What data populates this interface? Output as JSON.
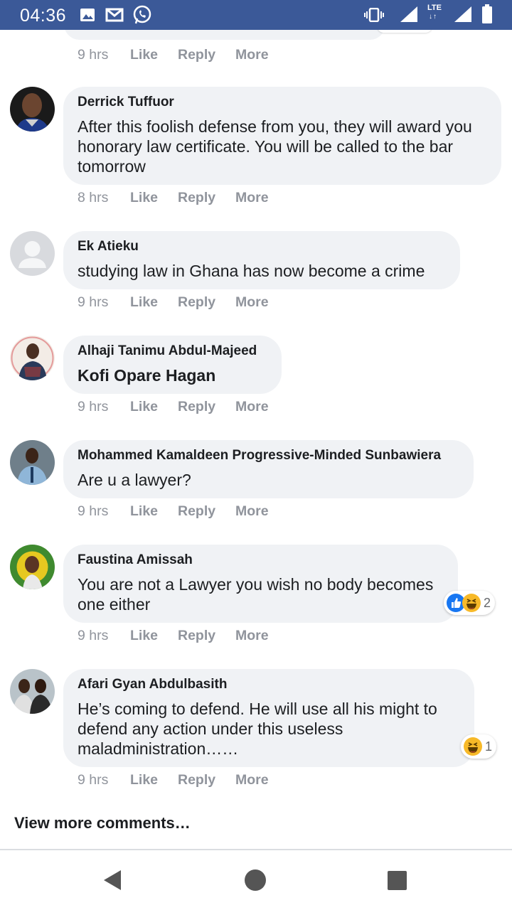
{
  "status_bar": {
    "time": "04:36",
    "network_label": "LTE",
    "network_arrows": "↓↑"
  },
  "comments": [
    {
      "author": "Derrick Tuffuor",
      "text": "After this foolish defense from you, they will award you honorary law certificate. You will be called to the bar tomorrow",
      "time": "8 hrs"
    },
    {
      "author": "Ek Atieku",
      "text": "studying law in Ghana has now become a crime",
      "time": "9 hrs"
    },
    {
      "author": "Alhaji Tanimu Abdul-Majeed",
      "text": "Kofi Opare Hagan",
      "time": "9 hrs"
    },
    {
      "author": "Mohammed Kamaldeen Progressive-Minded Sunbawiera",
      "text": "Are u a lawyer?",
      "time": "9 hrs"
    },
    {
      "author": "Faustina Amissah",
      "text": "You are not a Lawyer you wish no body becomes one either",
      "time": "9 hrs",
      "reaction_count": "2"
    },
    {
      "author": "Afari Gyan Abdulbasith",
      "text": "He’s coming to defend. He will use all his might to defend any action under this useless maladministration……",
      "time": "9 hrs",
      "reaction_count": "1"
    }
  ],
  "top_meta": {
    "time": "9 hrs"
  },
  "actions": {
    "like": "Like",
    "reply": "Reply",
    "more": "More"
  },
  "view_more": "View more comments…",
  "colors": {
    "header": "#3b5998",
    "bubble": "#f0f2f5",
    "meta": "#90949c",
    "like_blue": "#1877f2",
    "haha_yellow": "#f7b928"
  },
  "nav": {
    "back": "back-icon",
    "home": "home-icon",
    "recents": "recents-icon"
  }
}
